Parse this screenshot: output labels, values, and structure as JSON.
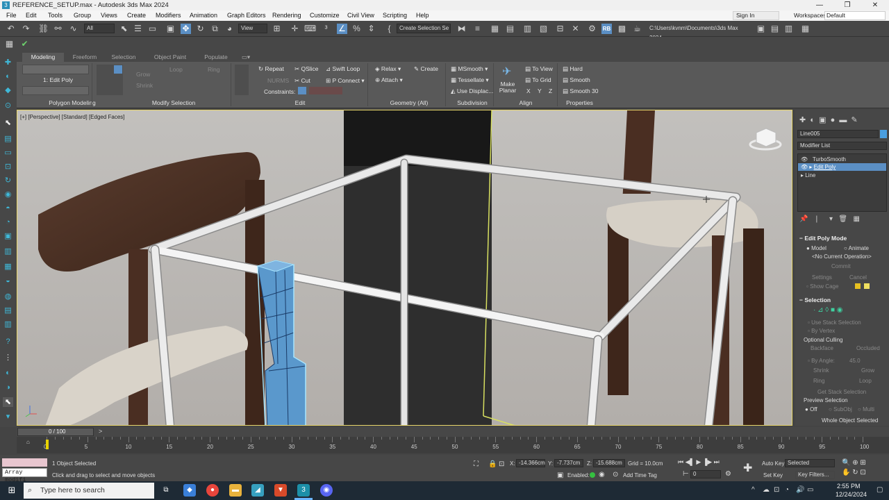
{
  "window": {
    "title": "REFERENCE_SETUP.max - Autodesk 3ds Max 2024",
    "app_icon": "3ds-max-icon",
    "controls": [
      "—",
      "❐",
      "✕"
    ]
  },
  "menu": {
    "items": [
      "File",
      "Edit",
      "Tools",
      "Group",
      "Views",
      "Create",
      "Modifiers",
      "Animation",
      "Graph Editors",
      "Rendering",
      "Customize",
      "Civil View",
      "Scripting",
      "Help"
    ],
    "signin": "Sign In",
    "workspaces_label": "Workspaces:",
    "workspace": "Default"
  },
  "toolbar": {
    "filter": "All",
    "view_ref": "View",
    "selection_set": "Create Selection Se",
    "project_path": "C:\\Users\\kvnm\\Documents\\3ds Max 2024",
    "rb_label": "RB"
  },
  "ribbon": {
    "tabs": [
      "Modeling",
      "Freeform",
      "Selection",
      "Object Paint",
      "Populate"
    ],
    "active_tab": "Modeling",
    "polygon_modeling": {
      "title": "Polygon Modeling",
      "level": "1: Edit Poly"
    },
    "modify_selection": {
      "title": "Modify Selection",
      "grow": "Grow",
      "shrink": "Shrink",
      "loop": "Loop",
      "ring": "Ring"
    },
    "edit": {
      "title": "Edit",
      "repeat": "Repeat",
      "qslice": "QSlice",
      "swift_loop": "Swift Loop",
      "nurms": "NURMS",
      "cut": "Cut",
      "p_connect": "P Connect",
      "constraints": "Constraints:"
    },
    "geometry": {
      "title": "Geometry (All)",
      "relax": "Relax",
      "create": "Create",
      "attach": "Attach"
    },
    "subdivision": {
      "title": "Subdivision",
      "msmooth": "MSmooth",
      "tessellate": "Tessellate",
      "use_displace": "Use Displac..."
    },
    "align": {
      "title": "Align",
      "make_planar": "Make Planar",
      "to_view": "To View",
      "to_grid": "To Grid",
      "x": "X",
      "y": "Y",
      "z": "Z"
    },
    "properties": {
      "title": "Properties",
      "hard": "Hard",
      "smooth": "Smooth",
      "smooth30": "Smooth 30"
    }
  },
  "viewport": {
    "label": "[+] [Perspective] [Standard] [Edged Faces]"
  },
  "command_panel": {
    "object_name": "Line005",
    "modifier_list": "Modifier List",
    "stack": [
      "TurboSmooth",
      "Edit Poly",
      "Line"
    ],
    "selected_stack": "Edit Poly",
    "edit_poly_mode": {
      "title": "Edit Poly Mode",
      "model": "Model",
      "animate": "Animate",
      "operation": "<No Current Operation>",
      "commit": "Commit",
      "settings": "Settings",
      "cancel": "Cancel",
      "show_cage": "Show Cage"
    },
    "selection": {
      "title": "Selection",
      "use_stack": "Use Stack Selection",
      "by_vertex": "By Vertex",
      "optional_culling": "Optional Culling",
      "backface": "Backface",
      "occluded": "Occluded",
      "by_angle": "By Angle:",
      "angle": "45.0",
      "shrink": "Shrink",
      "grow": "Grow",
      "ring": "Ring",
      "loop": "Loop",
      "get_stack": "Get Stack Selection",
      "preview": "Preview Selection",
      "off": "Off",
      "subobj": "SubObj",
      "multi": "Multi",
      "whole_object": "Whole Object Selected"
    }
  },
  "timeline": {
    "frame": "0 / 100",
    "ticks": [
      "0",
      "5",
      "10",
      "15",
      "20",
      "25",
      "30",
      "35",
      "40",
      "45",
      "50",
      "55",
      "60",
      "65",
      "70",
      "75",
      "80",
      "85",
      "90",
      "95",
      "100"
    ]
  },
  "status": {
    "maxscript": "Array modifi",
    "selected": "1 Object Selected",
    "prompt": "Click and drag to select and move objects",
    "x_label": "X:",
    "x": "-14.366cm",
    "y_label": "Y:",
    "y": "-7.737cm",
    "z_label": "Z:",
    "z": "-15.688cm",
    "grid": "Grid = 10.0cm",
    "enabled": "Enabled:",
    "add_time_tag": "Add Time Tag",
    "frame_field": "0",
    "auto_key": "Auto Key",
    "set_key": "Set Key",
    "key_mode": "Selected",
    "key_filters": "Key Filters..."
  },
  "taskbar": {
    "search": "Type here to search",
    "time": "2:55 PM",
    "date": "12/24/2024"
  }
}
